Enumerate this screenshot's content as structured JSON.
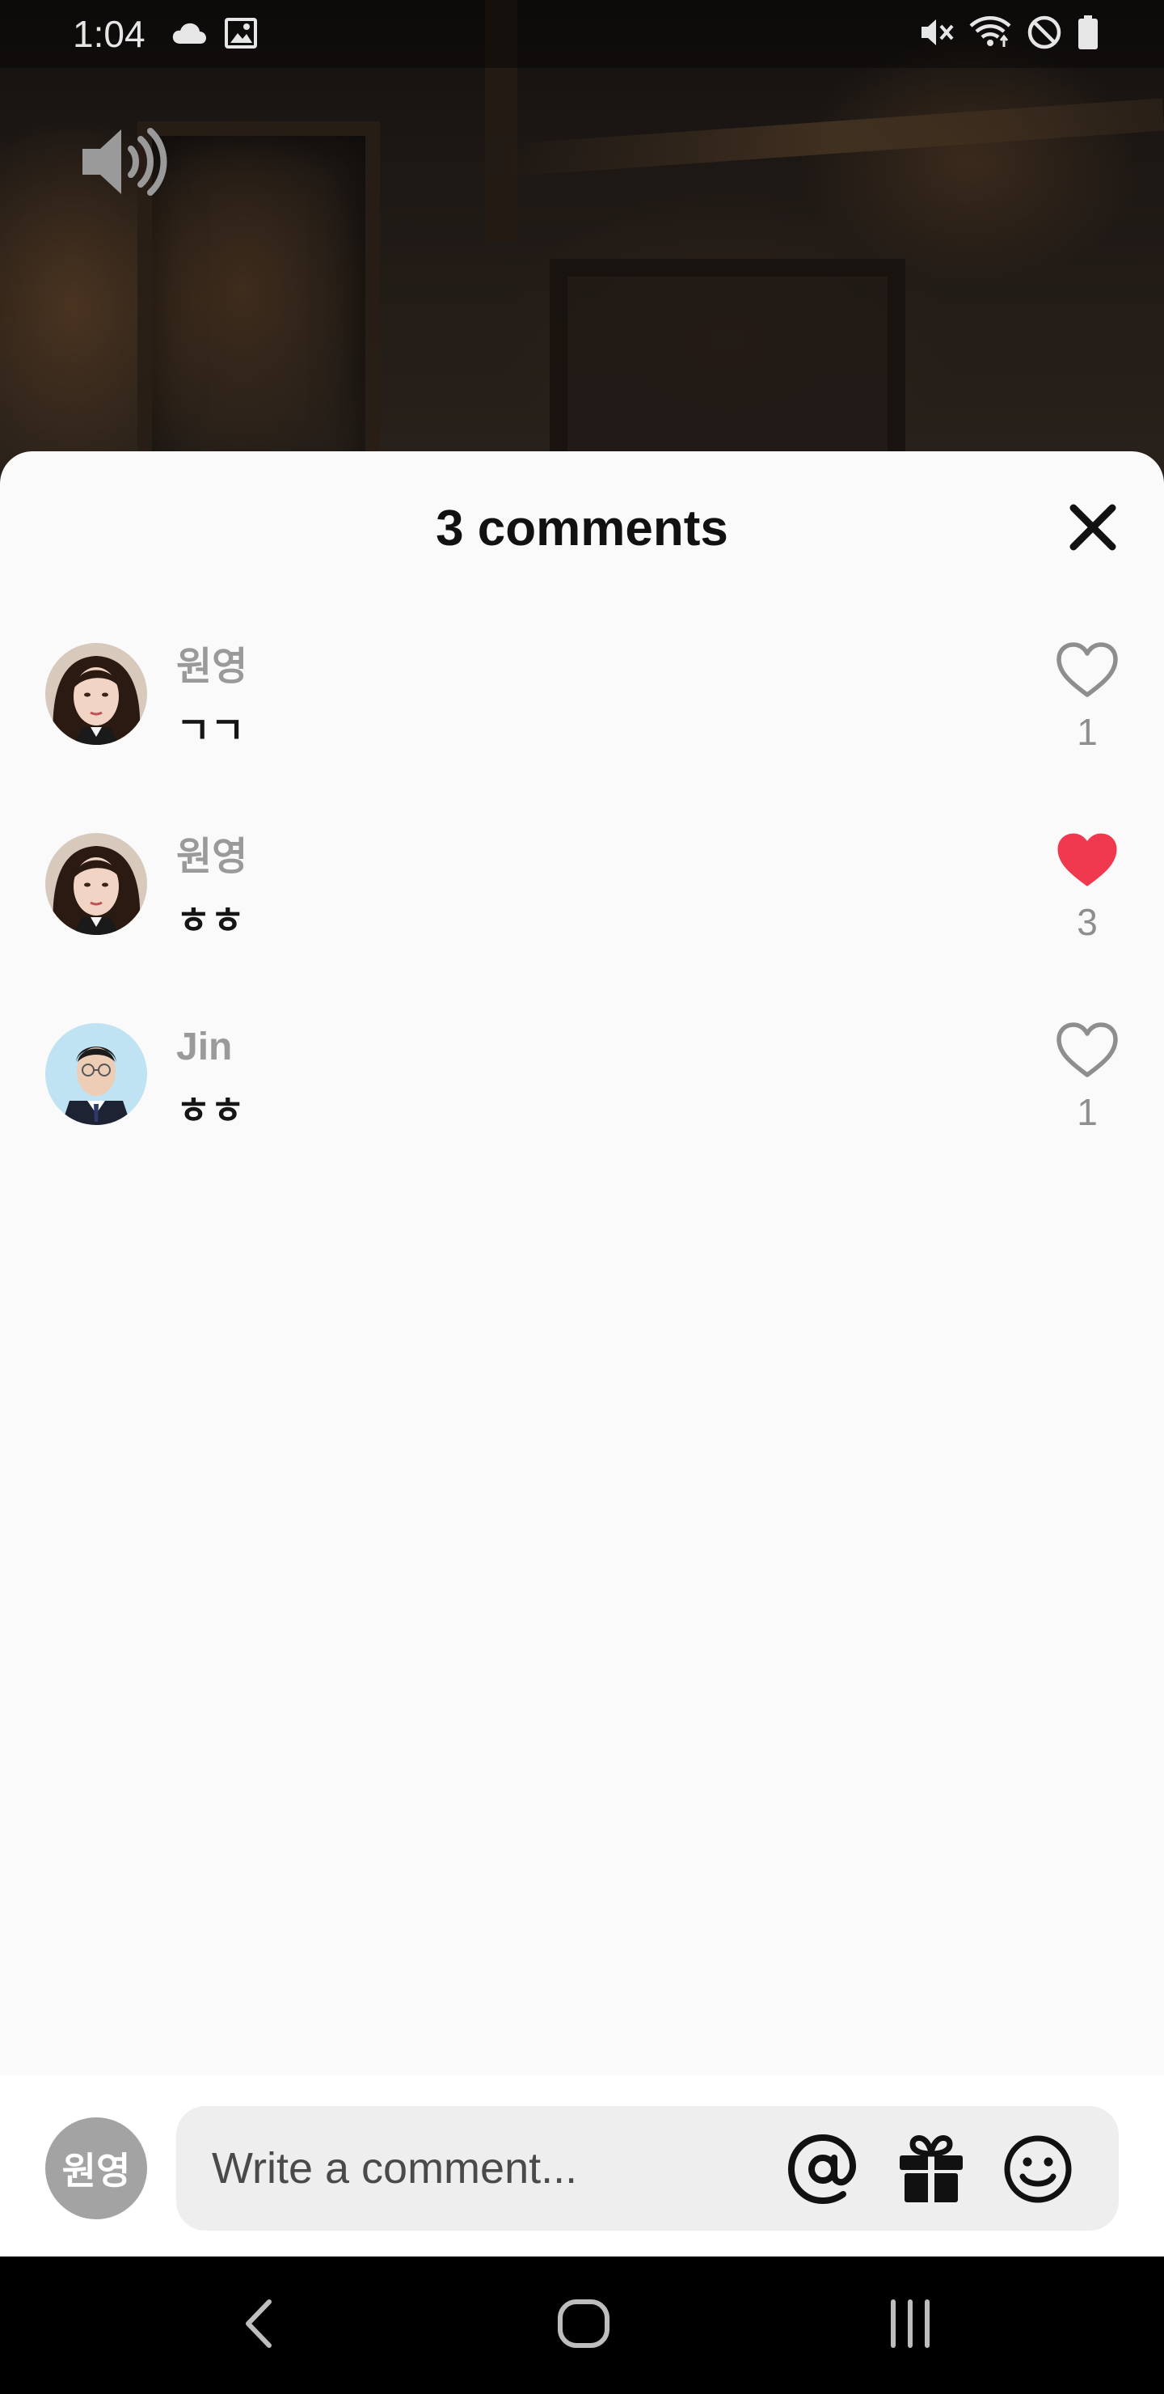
{
  "status_bar": {
    "time": "1:04",
    "left_icons": [
      "cloud-icon",
      "image-icon"
    ],
    "right_icons": [
      "mute-icon",
      "wifi-icon",
      "do-not-disturb-icon",
      "battery-icon"
    ]
  },
  "video": {
    "sound_icon": "volume-icon"
  },
  "sheet": {
    "title": "3 comments",
    "close_icon": "close-icon"
  },
  "comments": [
    {
      "user": "원영",
      "text": "ㄱㄱ",
      "likes": "1",
      "liked": false,
      "avatar": "avatar-wonyoung"
    },
    {
      "user": "원영",
      "text": "ㅎㅎ",
      "likes": "3",
      "liked": true,
      "avatar": "avatar-wonyoung"
    },
    {
      "user": "Jin",
      "text": "ㅎㅎ",
      "likes": "1",
      "liked": false,
      "avatar": "avatar-jin"
    }
  ],
  "composer": {
    "avatar_label": "원영",
    "placeholder": "Write a comment...",
    "buttons": [
      "mention-icon",
      "gift-icon",
      "emoji-icon"
    ]
  },
  "nav": {
    "buttons": [
      "back-icon",
      "home-icon",
      "recents-icon"
    ]
  },
  "colors": {
    "like_active": "#f0394f",
    "like_inactive": "#8e8e8e",
    "sheet_bg": "#fafafa",
    "composer_avatar_bg": "#a3a3a3"
  }
}
